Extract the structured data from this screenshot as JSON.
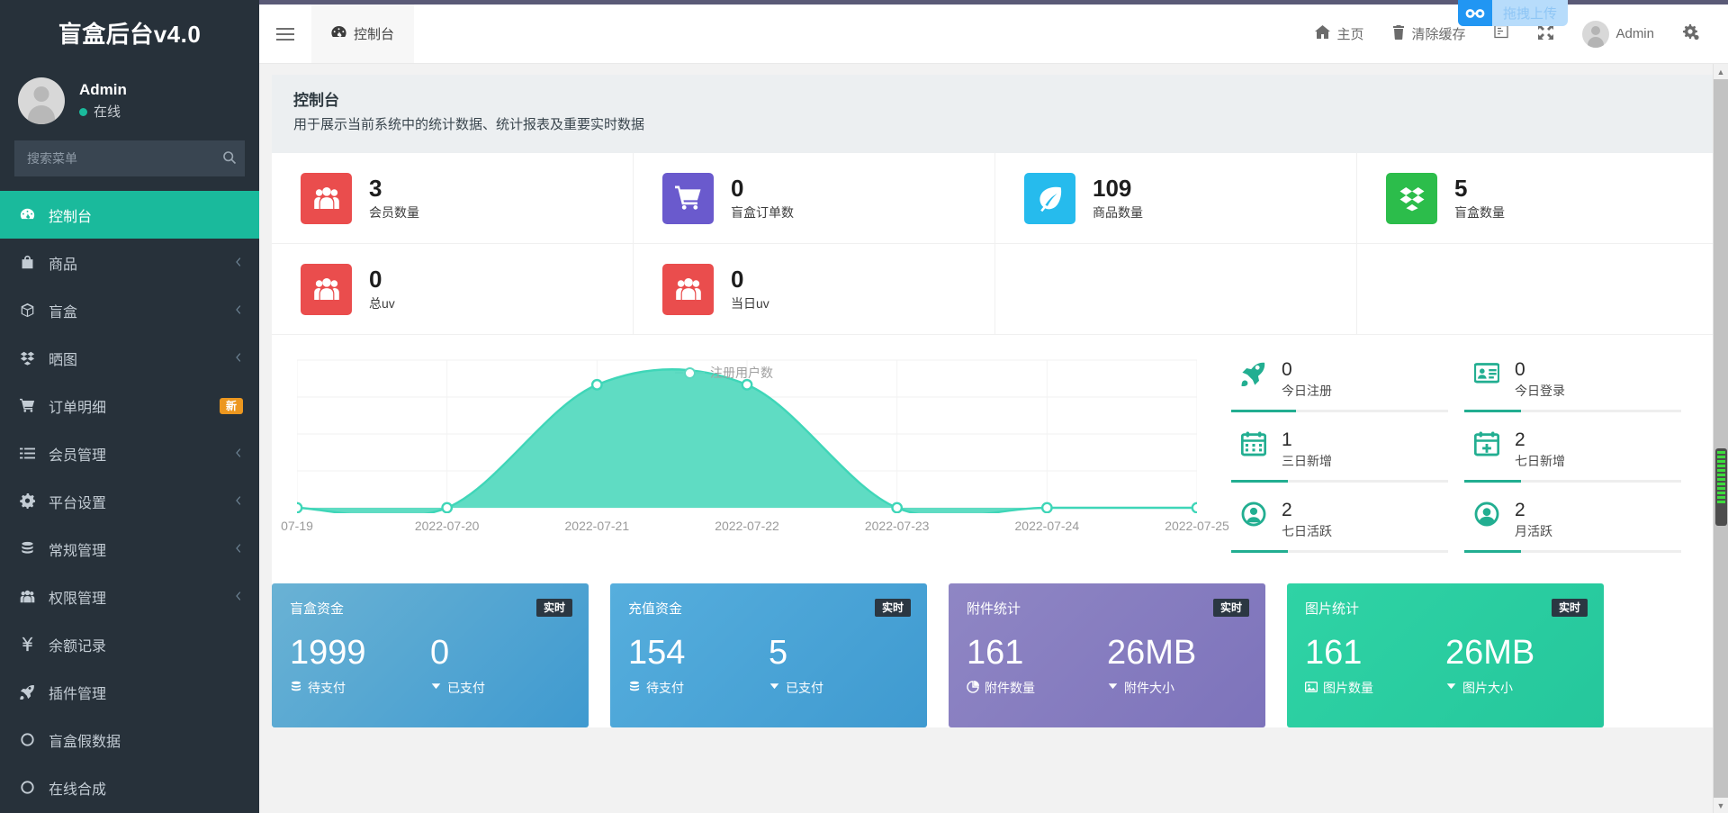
{
  "sidebar": {
    "brand": "盲盒后台v4.0",
    "user": {
      "name": "Admin",
      "status": "在线"
    },
    "search_placeholder": "搜索菜单",
    "items": [
      {
        "label": "控制台",
        "icon": "dashboard-icon",
        "active": true,
        "chevron": false,
        "badge": ""
      },
      {
        "label": "商品",
        "icon": "bag-icon",
        "active": false,
        "chevron": true,
        "badge": ""
      },
      {
        "label": "盲盒",
        "icon": "box-icon",
        "active": false,
        "chevron": true,
        "badge": ""
      },
      {
        "label": "晒图",
        "icon": "dropbox-icon",
        "active": false,
        "chevron": true,
        "badge": ""
      },
      {
        "label": "订单明细",
        "icon": "cart-icon",
        "active": false,
        "chevron": false,
        "badge": "新"
      },
      {
        "label": "会员管理",
        "icon": "list-icon",
        "active": false,
        "chevron": true,
        "badge": ""
      },
      {
        "label": "平台设置",
        "icon": "gear-icon",
        "active": false,
        "chevron": true,
        "badge": ""
      },
      {
        "label": "常规管理",
        "icon": "database-icon",
        "active": false,
        "chevron": true,
        "badge": ""
      },
      {
        "label": "权限管理",
        "icon": "users-icon",
        "active": false,
        "chevron": true,
        "badge": ""
      },
      {
        "label": "余额记录",
        "icon": "yen-icon",
        "active": false,
        "chevron": false,
        "badge": ""
      },
      {
        "label": "插件管理",
        "icon": "rocket-icon",
        "active": false,
        "chevron": false,
        "badge": ""
      },
      {
        "label": "盲盒假数据",
        "icon": "circle-icon",
        "active": false,
        "chevron": false,
        "badge": ""
      },
      {
        "label": "在线合成",
        "icon": "circle-icon",
        "active": false,
        "chevron": false,
        "badge": ""
      }
    ]
  },
  "header": {
    "tab_label": "控制台",
    "home_label": "主页",
    "clear_cache_label": "清除缓存",
    "user_name": "Admin",
    "drag_upload_label": "拖拽上传"
  },
  "page": {
    "title": "控制台",
    "subtitle": "用于展示当前系统中的统计数据、统计报表及重要实时数据"
  },
  "tiles": [
    {
      "value": "3",
      "label": "会员数量",
      "icon": "users-icon",
      "color": "#ea4d4d"
    },
    {
      "value": "0",
      "label": "盲盒订单数",
      "icon": "cart-icon",
      "color": "#6a5acd"
    },
    {
      "value": "109",
      "label": "商品数量",
      "icon": "leaf-icon",
      "color": "#26bbed"
    },
    {
      "value": "5",
      "label": "盲盒数量",
      "icon": "dropbox-icon",
      "color": "#2cbd4b"
    },
    {
      "value": "0",
      "label": "总uv",
      "icon": "users-icon",
      "color": "#ea4d4d"
    },
    {
      "value": "0",
      "label": "当日uv",
      "icon": "users-icon",
      "color": "#ea4d4d"
    }
  ],
  "chart_data": {
    "type": "area",
    "title": "",
    "legend": [
      "注册用户数"
    ],
    "legend_position": "top-center",
    "categories": [
      "07-19",
      "2022-07-20",
      "2022-07-21",
      "2022-07-22",
      "2022-07-23",
      "2022-07-24",
      "2022-07-25"
    ],
    "series": [
      {
        "name": "注册用户数",
        "values": [
          0,
          0,
          2,
          2,
          0,
          0,
          0
        ]
      }
    ],
    "ylim": [
      0,
      2.4
    ],
    "grid": true,
    "xlabel": "",
    "ylabel": "",
    "line_color": "#3fd6b8",
    "area_color": "#5fdcc3"
  },
  "mini_stats": [
    {
      "value": "0",
      "label": "今日注册",
      "icon": "rocket-icon",
      "progress": 30
    },
    {
      "value": "0",
      "label": "今日登录",
      "icon": "idcard-icon",
      "progress": 26
    },
    {
      "value": "1",
      "label": "三日新增",
      "icon": "calendar-icon",
      "progress": 26
    },
    {
      "value": "2",
      "label": "七日新增",
      "icon": "calendar-plus-icon",
      "progress": 26
    },
    {
      "value": "2",
      "label": "七日活跃",
      "icon": "user-circle-icon",
      "progress": 26
    },
    {
      "value": "2",
      "label": "月活跃",
      "icon": "user-circle-solid-icon",
      "progress": 26
    }
  ],
  "cards": [
    {
      "title": "盲盒资金",
      "badge": "实时",
      "num_left": "1999",
      "num_right": "0",
      "label_left": "待支付",
      "label_right": "已支付",
      "icon_left": "database-icon",
      "icon_right": "caret-down-icon",
      "color_from": "#6ab2d4",
      "color_to": "#3f9ad0"
    },
    {
      "title": "充值资金",
      "badge": "实时",
      "num_left": "154",
      "num_right": "5",
      "label_left": "待支付",
      "label_right": "已支付",
      "icon_left": "database-icon",
      "icon_right": "caret-down-icon",
      "color_from": "#56aedd",
      "color_to": "#3f9ad0"
    },
    {
      "title": "附件统计",
      "badge": "实时",
      "num_left": "161",
      "num_right": "26MB",
      "label_left": "附件数量",
      "label_right": "附件大小",
      "icon_left": "chart-icon",
      "icon_right": "caret-down-icon",
      "color_from": "#8f86c4",
      "color_to": "#7d73bb"
    },
    {
      "title": "图片统计",
      "badge": "实时",
      "num_left": "161",
      "num_right": "26MB",
      "label_left": "图片数量",
      "label_right": "图片大小",
      "icon_left": "image-icon",
      "icon_right": "caret-down-icon",
      "color_from": "#2fd3a5",
      "color_to": "#25c79c"
    }
  ]
}
